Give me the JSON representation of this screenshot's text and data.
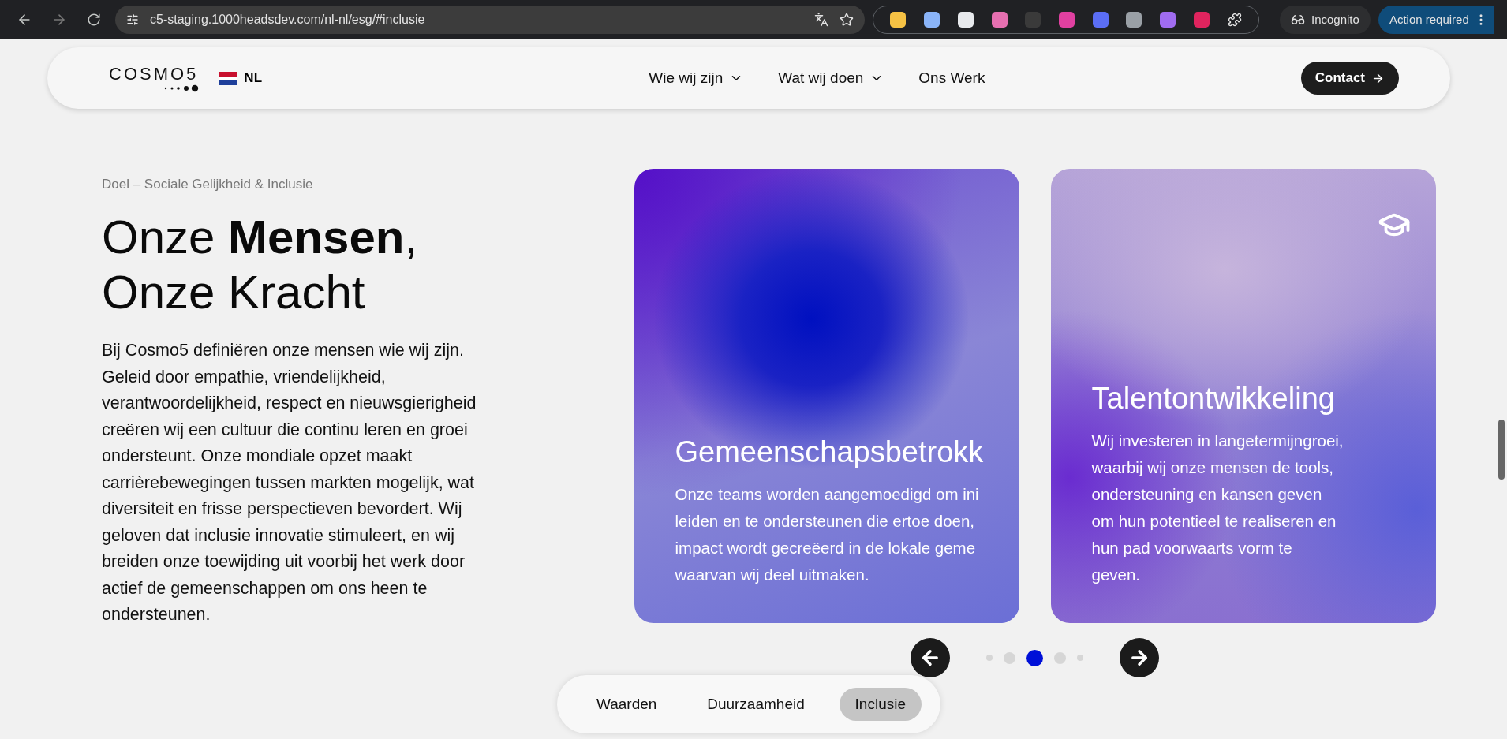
{
  "browser": {
    "url": "c5-staging.1000headsdev.com/nl-nl/esg/#inclusie",
    "profile": "Incognito",
    "action": "Action required"
  },
  "nav": {
    "logo": "COSMO5",
    "language": "NL",
    "links": [
      {
        "label": "Wie wij zijn",
        "dropdown": true
      },
      {
        "label": "Wat wij doen",
        "dropdown": true
      },
      {
        "label": "Ons Werk",
        "dropdown": false
      }
    ],
    "contact": "Contact"
  },
  "intro": {
    "eyebrow": "Doel – Sociale Gelijkheid & Inclusie",
    "heading": "Onze **Mensen**, Onze Kracht",
    "body": "Bij Cosmo5 definiëren onze mensen wie wij zijn. Geleid door empathie, vriendelijkheid, verantwoordelijkheid, respect en nieuwsgierigheid creëren wij een cultuur die continu leren en groei ondersteunt. Onze mondiale opzet maakt carrièrebewegingen tussen markten mogelijk, wat diversiteit en frisse perspectieven bevordert. Wij geloven dat inclusie innovatie stimuleert, en wij breiden onze toewijding uit voorbij het werk door actief de gemeenschappen om ons heen te ondersteunen."
  },
  "cards": [
    {
      "title": "Gemeenschapsbetrokk",
      "text": "Onze teams worden aangemoedigd om ini\nleiden en te ondersteunen die ertoe doen,\nimpact wordt gecreëerd in de lokale geme\nwaarvan wij deel uitmaken.",
      "icon": false
    },
    {
      "title": "Talentontwikkeling",
      "text": "Wij investeren in langetermijngroei, waarbij wij onze mensen de tools, ondersteuning en kansen geven om hun potentieel te realiseren en hun pad voorwaarts vorm te geven.",
      "icon": true
    }
  ],
  "carousel": {
    "dots": [
      {
        "selected": false
      },
      {
        "selected": false
      },
      {
        "selected": true
      },
      {
        "selected": false
      },
      {
        "selected": false
      }
    ]
  },
  "tabs": [
    {
      "label": "Waarden",
      "selected": false
    },
    {
      "label": "Duurzaamheid",
      "selected": false
    },
    {
      "label": "Inclusie",
      "selected": true
    }
  ]
}
